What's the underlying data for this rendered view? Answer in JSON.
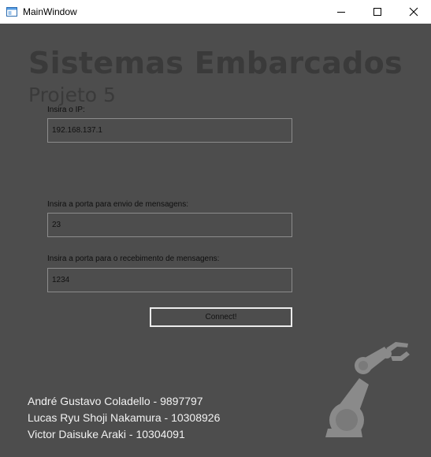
{
  "window": {
    "title": "MainWindow",
    "icon": "app-window-icon",
    "controls": [
      "minimize-icon",
      "maximize-icon",
      "close-icon"
    ]
  },
  "header": {
    "title": "Sistemas Embarcados",
    "subtitle": "Projeto 5"
  },
  "form": {
    "ip_label": "Insira o IP:",
    "ip_value": "192.168.137.1",
    "send_port_label": "Insira a porta para envio de mensagens:",
    "send_port_value": "23",
    "recv_port_label": "Insira a porta para o recebimento de mensagens:",
    "recv_port_value": "1234",
    "connect_label": "Connect!"
  },
  "authors": [
    "André Gustavo Coladello - 9897797",
    "Lucas Ryu Shoji Nakamura - 10308926",
    "Victor Daisuke Araki - 10304091"
  ],
  "colors": {
    "background": "#4d4d4d",
    "heading": "#3a3a3a",
    "author_text": "#f2f2f2",
    "robot_icon": "#8a8a8a"
  },
  "decor": {
    "logo_icon": "robot-arm-icon"
  }
}
